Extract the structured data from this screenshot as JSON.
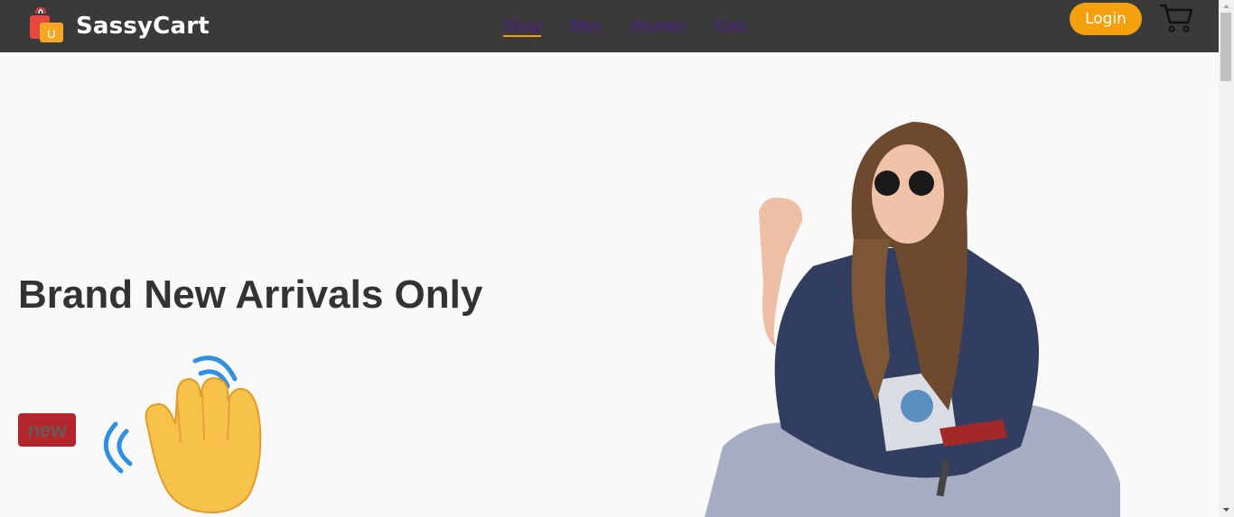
{
  "brand": {
    "name": "SassyCart",
    "logo_icon": "shopping-bag-icon",
    "logo_letter": "U"
  },
  "nav": {
    "links": [
      {
        "label": "Shop",
        "active": true
      },
      {
        "label": "Men",
        "active": false
      },
      {
        "label": "Women",
        "active": false
      },
      {
        "label": "Kids",
        "active": false
      }
    ]
  },
  "header": {
    "login_label": "Login",
    "cart_icon": "cart-icon"
  },
  "hero": {
    "title": "Brand New Arrivals Only",
    "badge": "new",
    "wave_icon": "waving-hand-icon",
    "image": "model-photo"
  },
  "colors": {
    "navbar": "#3a3a3a",
    "accent": "#f5a00f",
    "nav_link": "#4b1c86",
    "badge": "#b3262b",
    "title": "#333333"
  }
}
